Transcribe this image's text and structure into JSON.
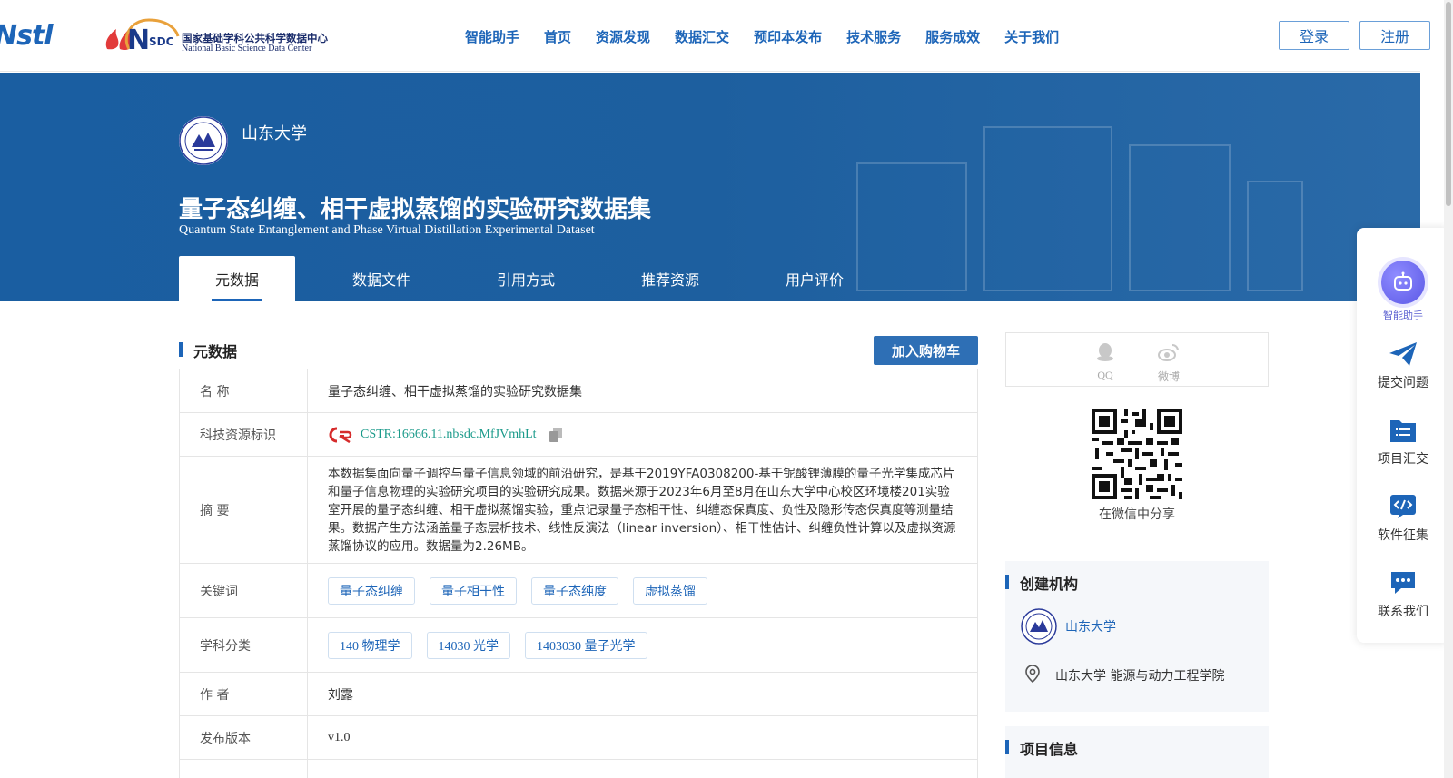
{
  "header": {
    "logo_nstl": "Nstl",
    "logo_nsdc_cn": "国家基础学科公共科学数据中心",
    "logo_nsdc_en": "National Basic Science Data Center",
    "nav": [
      "智能助手",
      "首页",
      "资源发现",
      "数据汇交",
      "预印本发布",
      "技术服务",
      "服务成效",
      "关于我们"
    ],
    "login_label": "登录",
    "register_label": "注册"
  },
  "hero": {
    "institution": "山东大学",
    "title_cn": "量子态纠缠、相干虚拟蒸馏的实验研究数据集",
    "title_en": "Quantum State Entanglement and Phase Virtual Distillation Experimental Dataset",
    "tabs": [
      "元数据",
      "数据文件",
      "引用方式",
      "推荐资源",
      "用户评价"
    ],
    "active_tab": "元数据"
  },
  "metadata": {
    "section_title": "元数据",
    "cart_label": "加入购物车",
    "rows": {
      "name_label": "名 称",
      "name_value": "量子态纠缠、相干虚拟蒸馏的实验研究数据集",
      "id_label": "科技资源标识",
      "id_value": "CSTR:16666.11.nbsdc.MfJVmhLt",
      "abstract_label": "摘 要",
      "abstract_value": "本数据集面向量子调控与量子信息领域的前沿研究，是基于2019YFA0308200-基于铌酸锂薄膜的量子光学集成芯片和量子信息物理的实验研究项目的实验研究成果。数据来源于2023年6月至8月在山东大学中心校区环境楼201实验室开展的量子态纠缠、相干虚拟蒸馏实验，重点记录量子态相干性、纠缠态保真度、负性及隐形传态保真度等测量结果。数据产生方法涵盖量子态层析技术、线性反演法（linear inversion）、相干性估计、纠缠负性计算以及虚拟资源蒸馏协议的应用。数据量为2.26MB。",
      "keywords_label": "关键词",
      "keywords": [
        "量子态纠缠",
        "量子相干性",
        "量子态纯度",
        "虚拟蒸馏"
      ],
      "subject_label": "学科分类",
      "subjects": [
        "140 物理学",
        "14030 光学",
        "1403030 量子光学"
      ],
      "author_label": "作 者",
      "author_value": "刘露",
      "version_label": "发布版本",
      "version_value": "v1.0"
    }
  },
  "share": {
    "qq_label": "QQ",
    "weibo_label": "微博",
    "wechat_label": "在微信中分享"
  },
  "org_panel": {
    "title": "创建机构",
    "org_name": "山东大学",
    "location": "山东大学 能源与动力工程学院"
  },
  "project_panel": {
    "title": "项目信息"
  },
  "float_bar": {
    "items": [
      "智能助手",
      "提交问题",
      "项目汇交",
      "软件征集",
      "联系我们"
    ]
  },
  "colors": {
    "brand": "#1d65b8",
    "hero_bg": "#1d5f9f",
    "link_green": "#1a9a8a",
    "ai_purple": "#5b58e6"
  }
}
